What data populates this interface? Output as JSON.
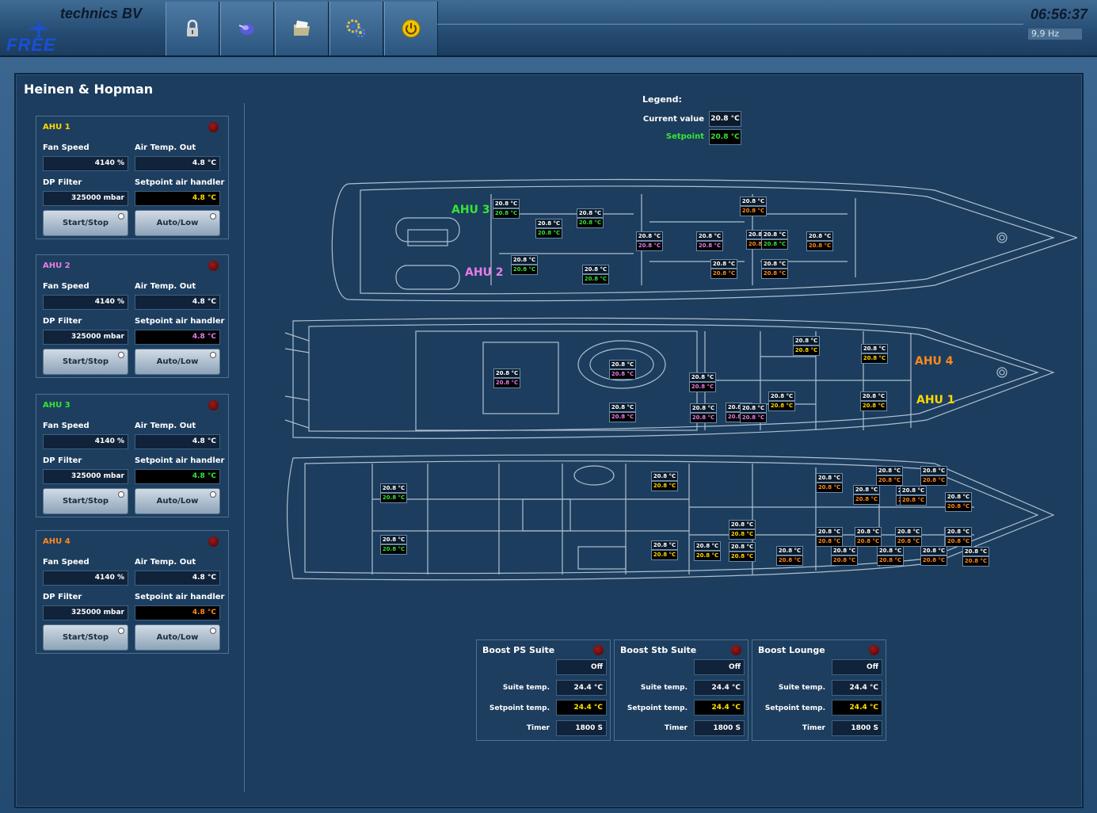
{
  "header": {
    "brand_title": "technics BV",
    "brand_logo_text": "FREE",
    "clock": "06:56:37",
    "frequency": "9,9 Hz",
    "toolbar": [
      {
        "name": "lock-icon"
      },
      {
        "name": "globe-icon"
      },
      {
        "name": "folder-icon"
      },
      {
        "name": "settings-icon"
      },
      {
        "name": "power-icon"
      }
    ]
  },
  "page": {
    "title": "Heinen & Hopman"
  },
  "labels": {
    "fan_speed": "Fan Speed",
    "air_temp_out": "Air Temp. Out",
    "dp_filter": "DP Filter",
    "setpoint_air_handler": "Setpoint air handler",
    "start_stop": "Start/Stop",
    "auto_low": "Auto/Low"
  },
  "ahus": [
    {
      "name": "AHU 1",
      "color": "#ffd800",
      "fan_speed": "4140 %",
      "air_temp_out": "4.8 °C",
      "dp_filter": "325000 mbar",
      "setpoint": "4.8 °C"
    },
    {
      "name": "AHU 2",
      "color": "#e87ce8",
      "fan_speed": "4140 %",
      "air_temp_out": "4.8 °C",
      "dp_filter": "325000 mbar",
      "setpoint": "4.8 °C"
    },
    {
      "name": "AHU 3",
      "color": "#34e634",
      "fan_speed": "4140 %",
      "air_temp_out": "4.8 °C",
      "dp_filter": "325000 mbar",
      "setpoint": "4.8 °C"
    },
    {
      "name": "AHU 4",
      "color": "#ff8a1a",
      "fan_speed": "4140 %",
      "air_temp_out": "4.8 °C",
      "dp_filter": "325000 mbar",
      "setpoint": "4.8 °C"
    }
  ],
  "legend": {
    "title": "Legend:",
    "current_label": "Current value",
    "current_value": "20.8 °C",
    "setpoint_label": "Setpoint",
    "setpoint_value": "20.8 °C",
    "setpoint_color": "#34e634"
  },
  "ship_labels": [
    {
      "text": "AHU 3",
      "color": "#34e634"
    },
    {
      "text": "AHU 2",
      "color": "#e87ce8"
    },
    {
      "text": "AHU 4",
      "color": "#ff8a1a"
    },
    {
      "text": "AHU 1",
      "color": "#ffd800"
    }
  ],
  "tag_colors": {
    "ahu1": "#ffd800",
    "ahu2": "#e87ce8",
    "ahu3": "#34e634",
    "ahu4": "#ff8a1a"
  },
  "ship_tags": [
    {
      "cv": "20.8 °C",
      "sv": "20.8 °C",
      "ahu": "ahu3"
    },
    {
      "cv": "20.8 °C",
      "sv": "20.8 °C",
      "ahu": "ahu3"
    },
    {
      "cv": "20.8 °C",
      "sv": "20.8 °C",
      "ahu": "ahu3"
    },
    {
      "cv": "20.8 °C",
      "sv": "20.8 °C",
      "ahu": "ahu3"
    },
    {
      "cv": "20.8 °C",
      "sv": "20.8 °C",
      "ahu": "ahu3"
    },
    {
      "cv": "20.8 °C",
      "sv": "20.8 °C",
      "ahu": "ahu2"
    },
    {
      "cv": "20.8 °C",
      "sv": "20.8 °C",
      "ahu": "ahu2"
    },
    {
      "cv": "20.8 °C",
      "sv": "20.8 °C",
      "ahu": "ahu4"
    },
    {
      "cv": "20.8 °C",
      "sv": "20.8 °C",
      "ahu": "ahu4"
    },
    {
      "cv": "20.8 °C",
      "sv": "20.8 °C",
      "ahu": "ahu4"
    },
    {
      "cv": "20.8 °C",
      "sv": "20.8 °C",
      "ahu": "ahu4"
    },
    {
      "cv": "20.8 °C",
      "sv": "20.8 °C",
      "ahu": "ahu4"
    },
    {
      "cv": "20.8 °C",
      "sv": "20.8 °C",
      "ahu": "ahu3"
    },
    {
      "cv": "20.8 °C",
      "sv": "20.8 °C",
      "ahu": "ahu2"
    },
    {
      "cv": "20.8 °C",
      "sv": "20.8 °C",
      "ahu": "ahu2"
    },
    {
      "cv": "20.8 °C",
      "sv": "20.8 °C",
      "ahu": "ahu2"
    },
    {
      "cv": "20.8 °C",
      "sv": "20.8 °C",
      "ahu": "ahu2"
    },
    {
      "cv": "20.8 °C",
      "sv": "20.8 °C",
      "ahu": "ahu2"
    },
    {
      "cv": "20.8 °C",
      "sv": "20.8 °C",
      "ahu": "ahu2"
    },
    {
      "cv": "20.8 °C",
      "sv": "20.8 °C",
      "ahu": "ahu2"
    },
    {
      "cv": "20.8 °C",
      "sv": "20.8 °C",
      "ahu": "ahu1"
    },
    {
      "cv": "20.8 °C",
      "sv": "20.8 °C",
      "ahu": "ahu1"
    },
    {
      "cv": "20.8 °C",
      "sv": "20.8 °C",
      "ahu": "ahu1"
    },
    {
      "cv": "20.8 °C",
      "sv": "20.8 °C",
      "ahu": "ahu1"
    },
    {
      "cv": "20.8 °C",
      "sv": "20.8 °C",
      "ahu": "ahu3"
    },
    {
      "cv": "20.8 °C",
      "sv": "20.8 °C",
      "ahu": "ahu3"
    },
    {
      "cv": "20.8 °C",
      "sv": "20.8 °C",
      "ahu": "ahu1"
    },
    {
      "cv": "20.8 °C",
      "sv": "20.8 °C",
      "ahu": "ahu1"
    },
    {
      "cv": "20.8 °C",
      "sv": "20.8 °C",
      "ahu": "ahu1"
    },
    {
      "cv": "20.8 °C",
      "sv": "20.8 °C",
      "ahu": "ahu1"
    },
    {
      "cv": "20.8 °C",
      "sv": "20.8 °C",
      "ahu": "ahu1"
    },
    {
      "cv": "20.8 °C",
      "sv": "20.8 °C",
      "ahu": "ahu4"
    },
    {
      "cv": "20.8 °C",
      "sv": "20.8 °C",
      "ahu": "ahu4"
    },
    {
      "cv": "20.8 °C",
      "sv": "20.8 °C",
      "ahu": "ahu4"
    },
    {
      "cv": "20.8 °C",
      "sv": "20.8 °C",
      "ahu": "ahu4"
    },
    {
      "cv": "20.8 °C",
      "sv": "20.8 °C",
      "ahu": "ahu4"
    },
    {
      "cv": "20.8 °C",
      "sv": "20.8 °C",
      "ahu": "ahu4"
    },
    {
      "cv": "20.8 °C",
      "sv": "20.8 °C",
      "ahu": "ahu4"
    },
    {
      "cv": "20.8 °C",
      "sv": "20.8 °C",
      "ahu": "ahu4"
    },
    {
      "cv": "20.8 °C",
      "sv": "20.8 °C",
      "ahu": "ahu4"
    },
    {
      "cv": "20.8 °C",
      "sv": "20.8 °C",
      "ahu": "ahu4"
    },
    {
      "cv": "20.8 °C",
      "sv": "20.8 °C",
      "ahu": "ahu4"
    },
    {
      "cv": "20.8 °C",
      "sv": "20.8 °C",
      "ahu": "ahu4"
    },
    {
      "cv": "20.8 °C",
      "sv": "20.8 °C",
      "ahu": "ahu4"
    },
    {
      "cv": "20.8 °C",
      "sv": "20.8 °C",
      "ahu": "ahu4"
    },
    {
      "cv": "20.8 °C",
      "sv": "20.8 °C",
      "ahu": "ahu4"
    },
    {
      "cv": "20.8 °C",
      "sv": "20.8 °C",
      "ahu": "ahu4"
    },
    {
      "cv": "20.8 °C",
      "sv": "20.8 °C",
      "ahu": "ahu4"
    }
  ],
  "boost_labels": {
    "suite_temp": "Suite temp.",
    "setpoint_temp": "Setpoint temp.",
    "timer": "Timer"
  },
  "boosts": [
    {
      "name": "Boost PS Suite",
      "state": "Off",
      "suite_temp": "24.4 °C",
      "setpoint_temp": "24.4 °C",
      "timer": "1800 S"
    },
    {
      "name": "Boost Stb Suite",
      "state": "Off",
      "suite_temp": "24.4 °C",
      "setpoint_temp": "24.4 °C",
      "timer": "1800 S"
    },
    {
      "name": "Boost Lounge",
      "state": "Off",
      "suite_temp": "24.4 °C",
      "setpoint_temp": "24.4 °C",
      "timer": "1800 S"
    }
  ]
}
